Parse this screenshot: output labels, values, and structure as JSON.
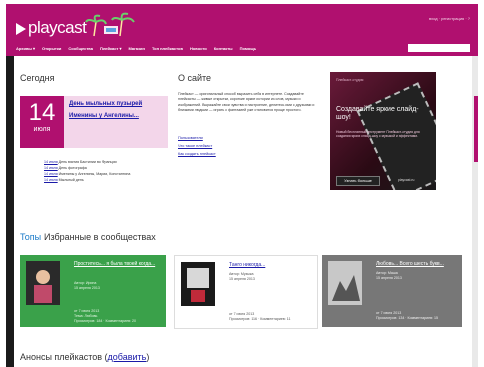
{
  "header": {
    "logo_text": "playcast",
    "user_links": "вход · регистрация · ?",
    "nav": [
      "Архивы ▾",
      "Открытки",
      "Сообщества",
      "Плейкаст ▾",
      "Магазин",
      "Топ плейкастов",
      "Новости",
      "Контакты",
      "Помощь"
    ],
    "search_placeholder": ""
  },
  "today": {
    "heading": "Сегодня",
    "day": "14",
    "month": "июля",
    "events": [
      "День мыльных пузырей",
      "Именины у Ангелины..."
    ],
    "minor_events": [
      {
        "date": "14 июля",
        "text": "День взятия Бастилии во Франции"
      },
      {
        "date": "14 июля",
        "text": "День фотографа"
      },
      {
        "date": "14 июля",
        "text": "Именины у Ангелины, Марии, Константина"
      },
      {
        "date": "14 июля",
        "text": "Мыльный день"
      }
    ]
  },
  "about": {
    "heading": "О сайте",
    "text": "Плейкаст — оригинальный способ выразить себя в интернете. Создавайте плейкасты — живые открытки, короткие яркие истории из слов, музыки и изображений. Выражайте свои чувства и настроение, делитесь ими с друзьями и близкими людьми — играть с фантазией уже становится проще простого.",
    "links": [
      "Пользователи",
      "Что такое плейкаст",
      "Как создать плейкаст"
    ]
  },
  "promo": {
    "small_label": "Плейкаст-студия",
    "title": "Создавайте яркие слайд-шоу!",
    "subtitle": "Новый бесплатный инструмент Плейкаст-студия для создания ярких слайд-шоу с музыкой и эффектами.",
    "button": "Узнать больше",
    "tag": "playcast.ru"
  },
  "tops": {
    "tab1": "Топы",
    "tab2": "Избранные в сообществах",
    "cards": [
      {
        "title": "Проститесь... я была твоей когда...",
        "author": "Автор: Ирина",
        "date": "15 апреля 2013",
        "footer1": "от 7 июля 2013",
        "footer2": "Тема: Любовь",
        "footer3": "Просмотров: 184 · Комментариев: 20"
      },
      {
        "title": "Танго никогда...",
        "author": "Автор: Музыка",
        "date": "15 апреля 2013",
        "footer1": "от 7 июля 2013",
        "footer2": "Просмотров: 116 · Комментариев: 11",
        "footer3": ""
      },
      {
        "title": "Любовь... Всего шесть букв...",
        "author": "Автор: Маша",
        "date": "15 апреля 2013",
        "footer1": "от 7 июля 2013",
        "footer2": "Просмотров: 134 · Комментариев: 15",
        "footer3": ""
      }
    ]
  },
  "announce": {
    "text": "Анонсы плейкастов (",
    "link": "добавить",
    "close": ")"
  },
  "colors": {
    "brand": "#b0106f",
    "green_card": "#3aa14a",
    "gray_card": "#777777"
  }
}
